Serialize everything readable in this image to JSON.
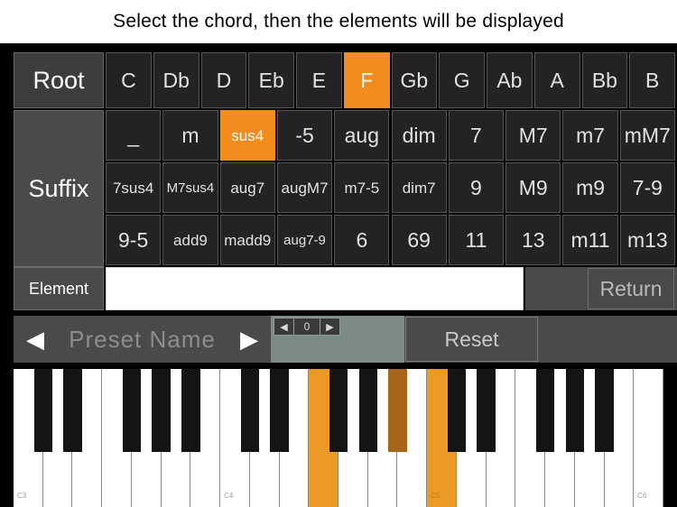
{
  "header": {
    "title": "Select the chord, then the elements will be displayed"
  },
  "root": {
    "label": "Root",
    "notes": [
      "C",
      "Db",
      "D",
      "Eb",
      "E",
      "F",
      "Gb",
      "G",
      "Ab",
      "A",
      "Bb",
      "B"
    ],
    "selected": "F"
  },
  "suffix": {
    "label": "Suffix",
    "selected": "sus4",
    "rows": [
      [
        "_",
        "m",
        "sus4",
        "-5",
        "aug",
        "dim",
        "7",
        "M7",
        "m7",
        "mM7"
      ],
      [
        "7sus4",
        "M7sus4",
        "aug7",
        "augM7",
        "m7-5",
        "dim7",
        "9",
        "M9",
        "m9",
        "7-9"
      ],
      [
        "9-5",
        "add9",
        "madd9",
        "aug7-9",
        "6",
        "69",
        "11",
        "13",
        "m11",
        "m13"
      ]
    ]
  },
  "element": {
    "label": "Element",
    "value": "",
    "return_label": "Return"
  },
  "preset": {
    "prev_icon": "left-triangle-icon",
    "next_icon": "right-triangle-icon",
    "name_placeholder": "Preset Name",
    "name_value": "",
    "stepper_value": "0",
    "stepper_prev_icon": "left-triangle-icon",
    "stepper_next_icon": "right-triangle-icon",
    "reset_label": "Reset"
  },
  "keyboard": {
    "octave_labels": [
      "C3",
      "C4",
      "C5",
      "C6"
    ],
    "highlighted_white": [
      "F4",
      "C5"
    ],
    "highlighted_black": [
      "Bb4"
    ],
    "colors": {
      "white_on": "#eb9a25",
      "black_on": "#a9661a",
      "accent": "#f28c1c"
    }
  }
}
